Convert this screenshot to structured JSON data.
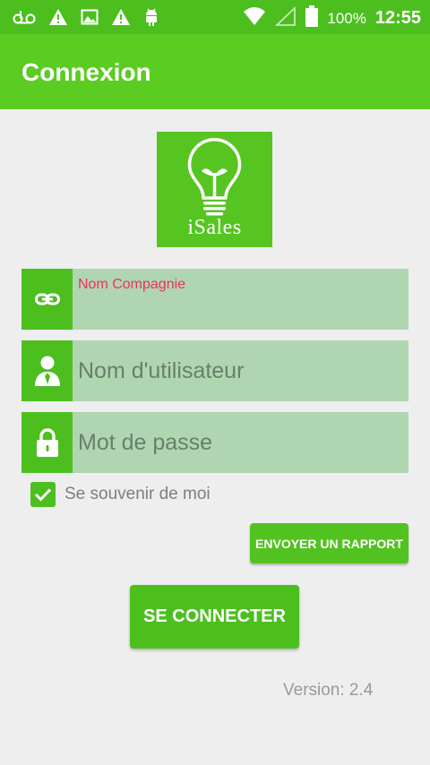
{
  "status_bar": {
    "icons_left": [
      "voicemail-icon",
      "warning-icon",
      "image-icon",
      "warning-icon",
      "android-icon"
    ],
    "icons_right": [
      "wifi-icon",
      "signal-icon",
      "battery-icon"
    ],
    "battery": "100%",
    "time": "12:55"
  },
  "app_bar": {
    "title": "Connexion"
  },
  "logo": {
    "text": "iSales"
  },
  "form": {
    "company": {
      "label": "Nom Compagnie",
      "value": ""
    },
    "username": {
      "placeholder": "Nom d'utilisateur",
      "value": ""
    },
    "password": {
      "placeholder": "Mot de passe",
      "value": ""
    },
    "remember": {
      "label": "Se souvenir de moi",
      "checked": true
    }
  },
  "buttons": {
    "report": "ENVOYER UN RAPPORT",
    "connect": "SE CONNECTER"
  },
  "version": "Version: 2.4",
  "colors": {
    "primary": "#4cbf1f",
    "app_bar": "#5bcc22",
    "field_bg": "#afd6b1",
    "label_accent": "#e8345c",
    "background": "#eeeeee"
  }
}
